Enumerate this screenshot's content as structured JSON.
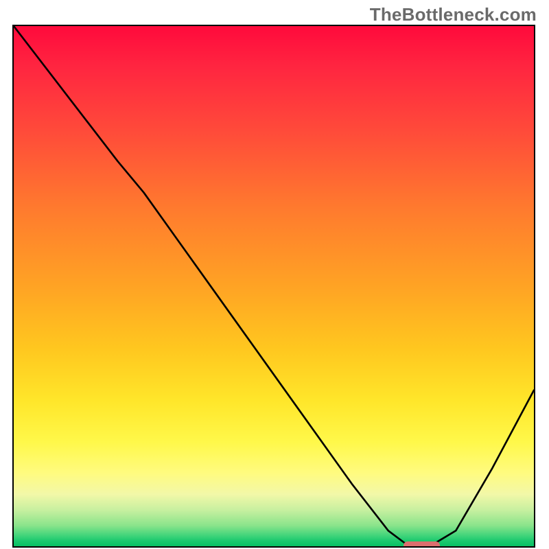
{
  "watermark": "TheBottleneck.com",
  "colors": {
    "border": "#000000",
    "curve": "#000000",
    "marker": "#db6e6e",
    "gradient_top": "#ff0a3c",
    "gradient_bottom": "#08c064"
  },
  "chart_data": {
    "type": "line",
    "title": "",
    "xlabel": "",
    "ylabel": "",
    "xlim": [
      0,
      100
    ],
    "ylim": [
      0,
      100
    ],
    "grid": false,
    "legend": false,
    "series": [
      {
        "name": "bottleneck-curve",
        "x": [
          0,
          10,
          20,
          25,
          35,
          45,
          55,
          65,
          72,
          76,
          80,
          85,
          92,
          100
        ],
        "y": [
          100,
          87,
          74,
          68,
          54,
          40,
          26,
          12,
          3,
          0,
          0,
          3,
          15,
          30
        ]
      }
    ],
    "marker": {
      "x_start": 75,
      "x_end": 82,
      "y": 0
    }
  }
}
